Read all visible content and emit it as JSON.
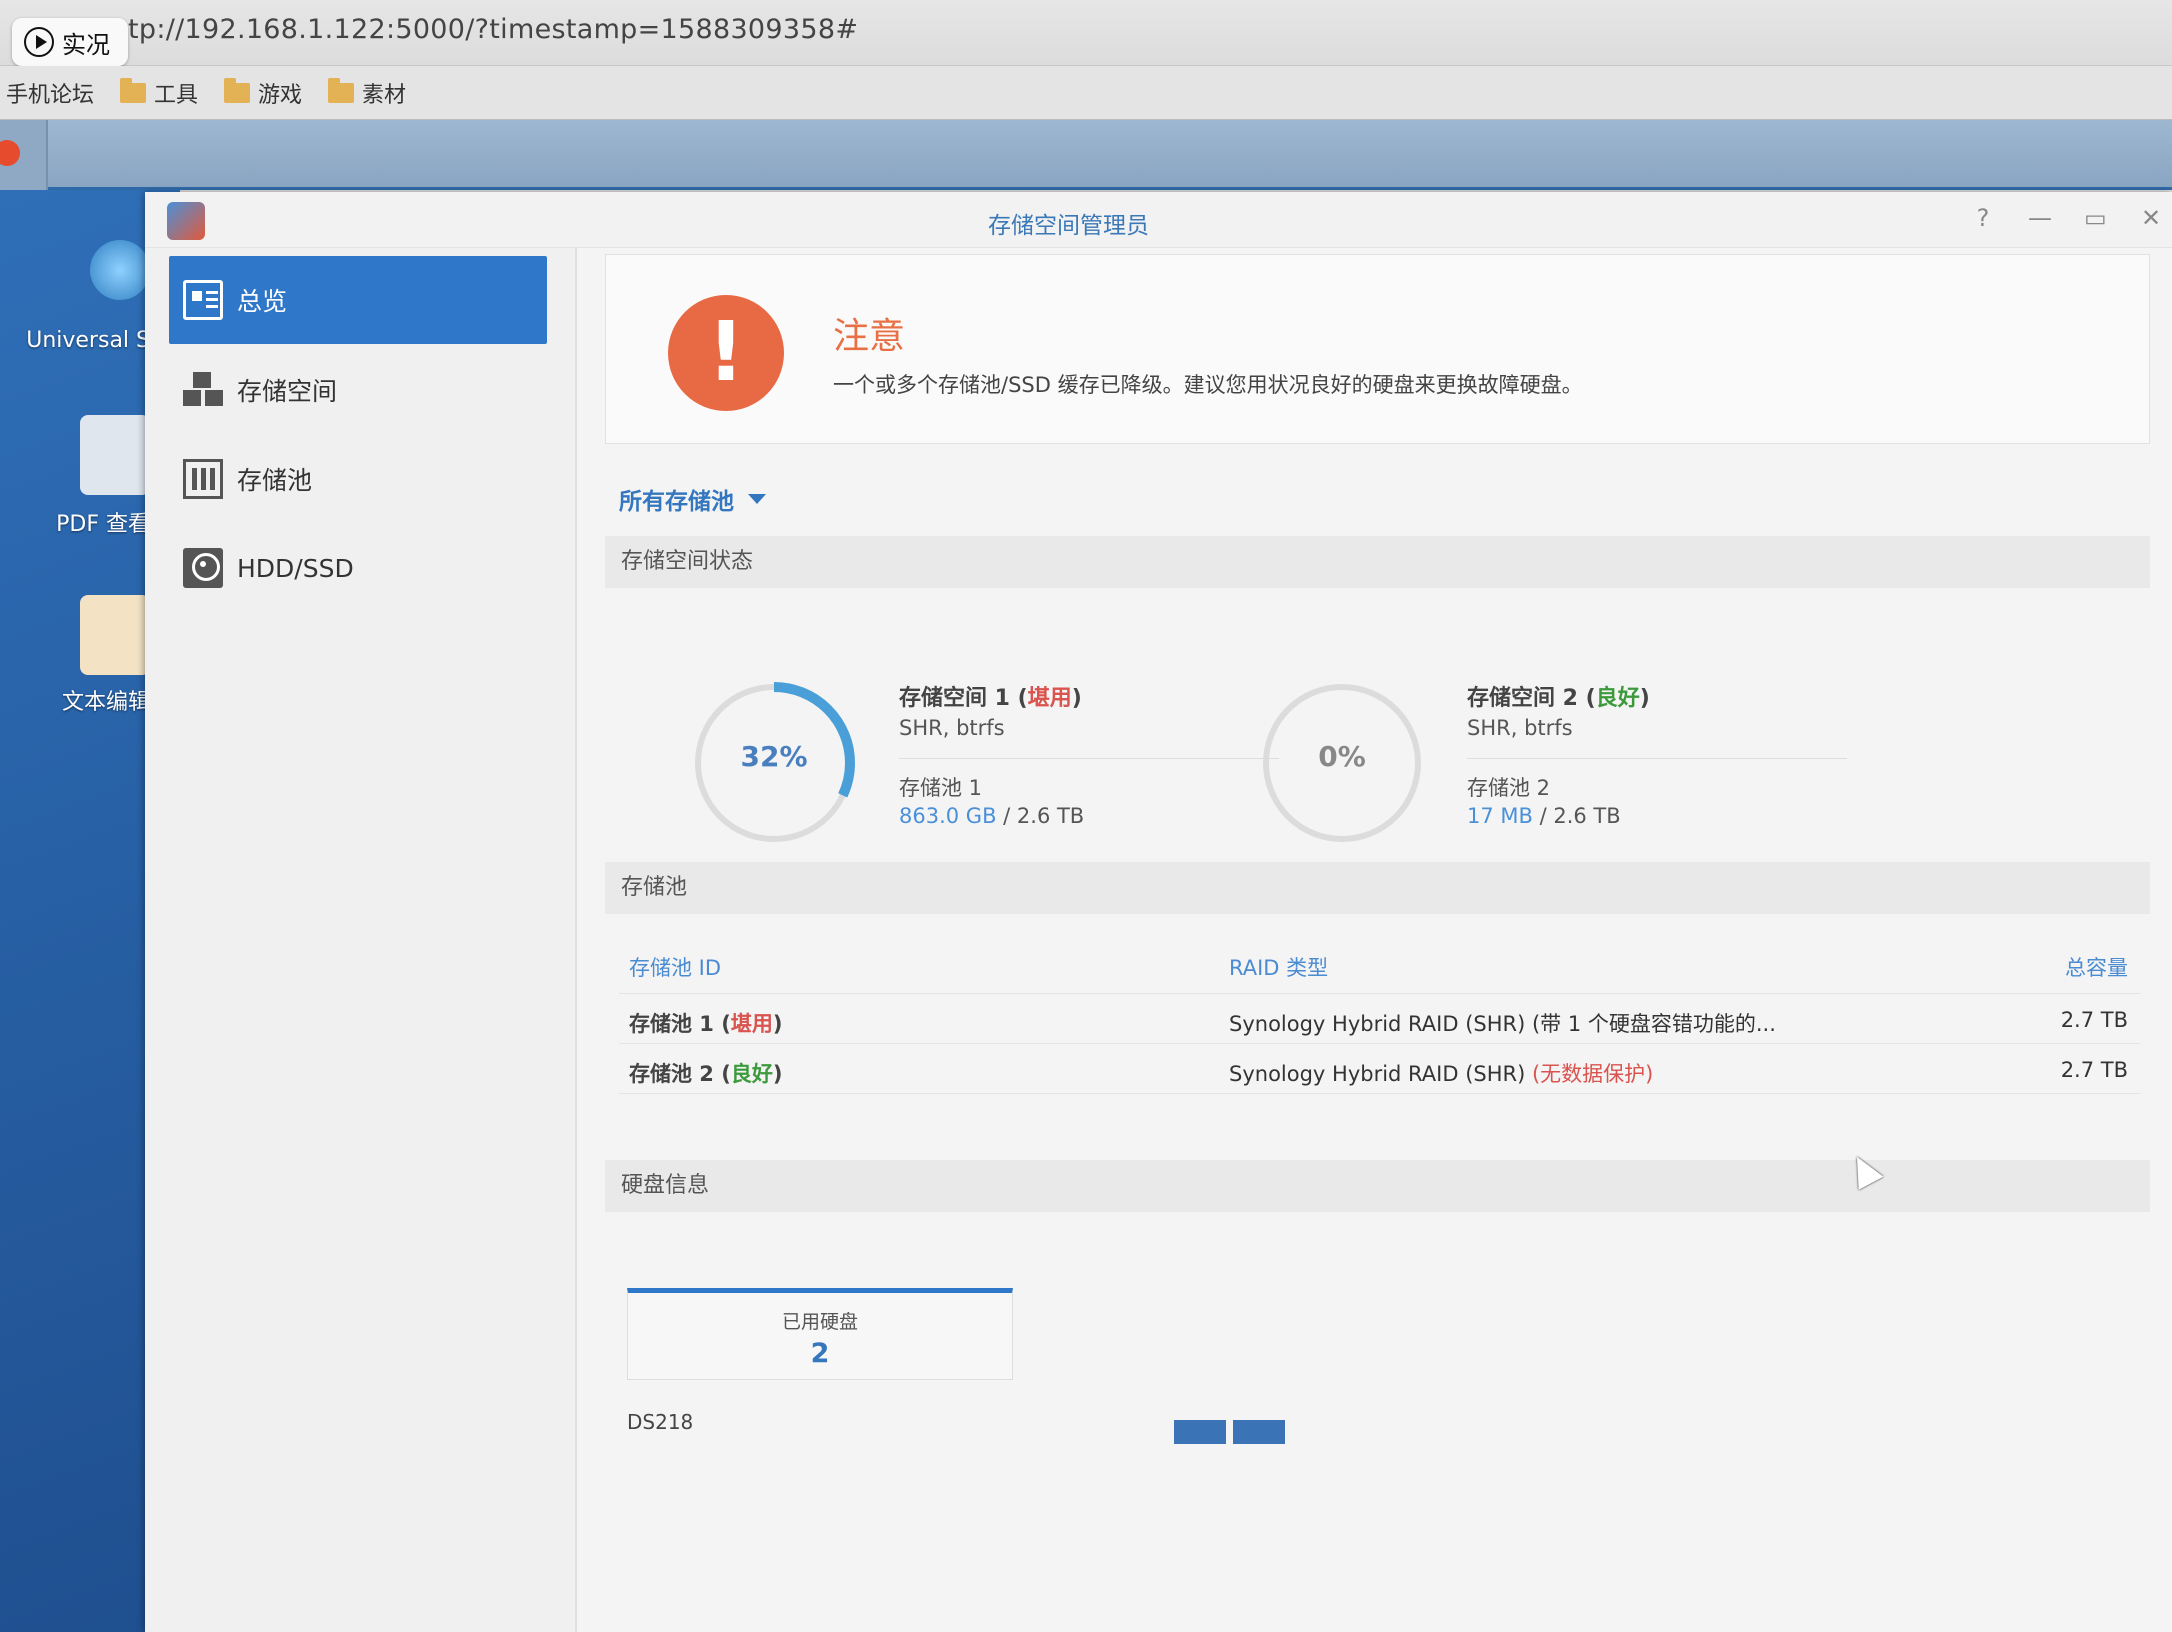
{
  "browser": {
    "live_label": "实况",
    "url": "tp://192.168.1.122:5000/?timestamp=1588309358#",
    "bookmarks": [
      "手机论坛",
      "工具",
      "游戏",
      "素材"
    ]
  },
  "desktop": {
    "icons": [
      "Universal S",
      "PDF 查看",
      "文本编辑"
    ]
  },
  "window": {
    "title": "存储空间管理员",
    "controls": [
      "?",
      "—",
      "▭",
      "✕"
    ]
  },
  "sidebar": {
    "items": [
      {
        "label": "总览",
        "active": true
      },
      {
        "label": "存储空间"
      },
      {
        "label": "存储池"
      },
      {
        "label": "HDD/SSD"
      }
    ]
  },
  "alert": {
    "icon": "!",
    "title": "注意",
    "message": "一个或多个存储池/SSD 缓存已降级。建议您用状况良好的硬盘来更换故障硬盘。"
  },
  "filter": {
    "label": "所有存储池"
  },
  "sections": {
    "volume_status": "存储空间状态",
    "pools": "存储池",
    "disk_info": "硬盘信息"
  },
  "volumes": [
    {
      "name": "存储空间 1 (",
      "status": "堪用",
      "close": ")",
      "fs": "SHR, btrfs",
      "pool": "存储池 1",
      "used": "863.0 GB",
      "total": " / 2.6 TB",
      "percent_label": "32%",
      "percent": 32,
      "color": "#4a9fd8"
    },
    {
      "name": "存储空间 2 (",
      "status": "良好",
      "close": ")",
      "fs": "SHR, btrfs",
      "pool": "存储池 2",
      "used": "17 MB",
      "total": " / 2.6 TB",
      "percent_label": "0%",
      "percent": 0,
      "color": "#4a9fd8"
    }
  ],
  "pool_table": {
    "headers": [
      "存储池 ID",
      "RAID 类型",
      "总容量"
    ],
    "rows": [
      {
        "id": "存储池 1 (",
        "status": "堪用",
        "close": ")",
        "raid": "Synology Hybrid RAID (SHR) (带 1 个硬盘容错功能的...",
        "raid_note": "",
        "capacity": "2.7 TB"
      },
      {
        "id": "存储池 2 (",
        "status": "良好",
        "close": ")",
        "raid": "Synology Hybrid RAID (SHR) ",
        "raid_note": "(无数据保护)",
        "capacity": "2.7 TB"
      }
    ]
  },
  "disk_info": {
    "used_label": "已用硬盘",
    "used_count": "2",
    "model": "DS218",
    "slots": 2
  },
  "colors": {
    "accent": "#2f78c9",
    "warning": "#e76a44",
    "bad": "#d9534f",
    "good": "#3c9a3c"
  }
}
